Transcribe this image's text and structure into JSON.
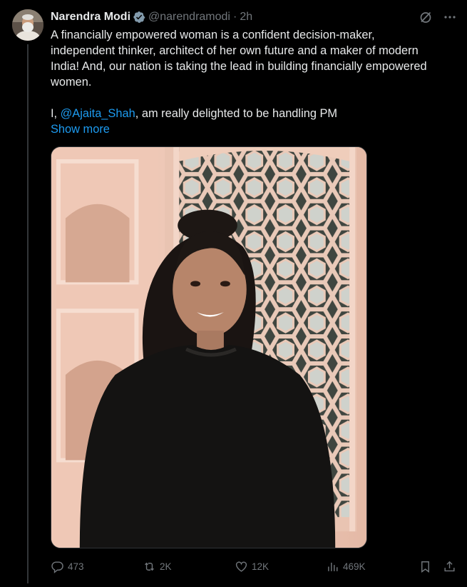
{
  "author": {
    "name": "Narendra Modi",
    "handle": "@narendramodi",
    "separator": "·",
    "time": "2h",
    "verified_icon": "verified-badge-icon"
  },
  "top_icons": [
    "grok-icon",
    "more-icon"
  ],
  "tweet": {
    "line1": "A financially empowered woman is a confident decision-maker,",
    "line2": "independent thinker, architect of her own future and a maker of modern",
    "line3": "India! And, our nation is taking the lead in building financially empowered",
    "line4": "women.",
    "line5_prefix": "I, ",
    "mention": "@Ajaita_Shah",
    "line5_suffix": ", am really delighted to be handling PM",
    "show_more": "Show more"
  },
  "actions": {
    "replies": "473",
    "reposts": "2K",
    "likes": "12K",
    "views": "469K"
  },
  "colors": {
    "background": "#000000",
    "text": "#e7e9ea",
    "muted": "#71767b",
    "link": "#1d9bf0",
    "verified": "#829aab"
  }
}
